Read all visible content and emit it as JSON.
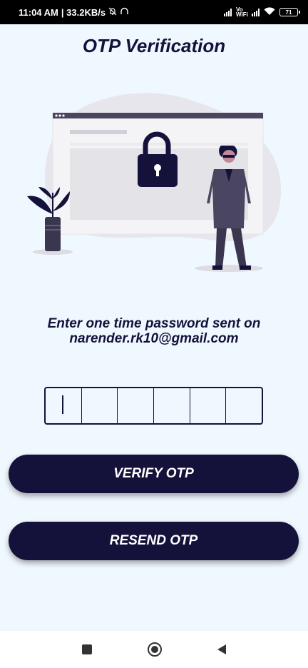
{
  "status_bar": {
    "time": "11:04 AM",
    "network_speed": "| 33.2KB/s",
    "volte_label": "Vo WiFi",
    "battery": "71"
  },
  "screen": {
    "title": "OTP Verification",
    "instruction_line1": "Enter one time password sent on",
    "instruction_line2": "narender.rk10@gmail.com"
  },
  "otp": {
    "digits": [
      "",
      "",
      "",
      "",
      "",
      ""
    ],
    "active_index": 0
  },
  "buttons": {
    "verify_label": "VERIFY OTP",
    "resend_label": "RESEND OTP"
  },
  "colors": {
    "primary": "#14123a",
    "background": "#f0f8ff"
  },
  "icons": {
    "status": [
      "muted-bell-icon",
      "headphones-icon",
      "signal-icon",
      "wifi-icon",
      "battery-icon"
    ],
    "nav": [
      "recents-icon",
      "home-icon",
      "back-icon"
    ]
  }
}
